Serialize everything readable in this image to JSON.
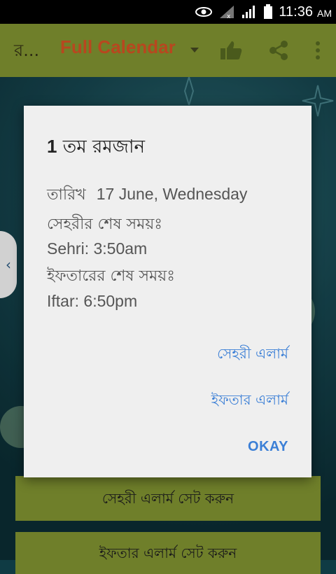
{
  "status_bar": {
    "time": "11:36",
    "ampm": "AM"
  },
  "app_bar": {
    "title": "র...",
    "dropdown_label": "Full Calendar",
    "colors": {
      "bar": "#6f7f2a",
      "dropdown_text": "#b8471f"
    }
  },
  "dialog": {
    "title_number": "1",
    "title_text": "তম রমজান",
    "date_label": "তারিখ",
    "date_value": "17 June, Wednesday",
    "sehri_end_label": "সেহরীর শেষ সময়ঃ",
    "sehri_time": "Sehri: 3:50am",
    "iftar_end_label": "ইফতারের শেষ সময়ঃ",
    "iftar_time": "Iftar: 6:50pm",
    "sehri_alarm_link": "সেহরী এলার্ম",
    "iftar_alarm_link": "ইফতার এলার্ম",
    "okay_button": "OKAY",
    "link_color": "#3b7fd6"
  },
  "background_buttons": {
    "set_sehri_alarm": "সেহরী এলার্ম সেট করুন",
    "set_iftar_alarm": "ইফতার এলার্ম সেট করুন"
  },
  "icons": [
    "eye-icon",
    "no-signal-icon",
    "signal-icon",
    "battery-icon",
    "like-icon",
    "share-icon",
    "overflow-menu-icon",
    "chevron-left-icon"
  ]
}
